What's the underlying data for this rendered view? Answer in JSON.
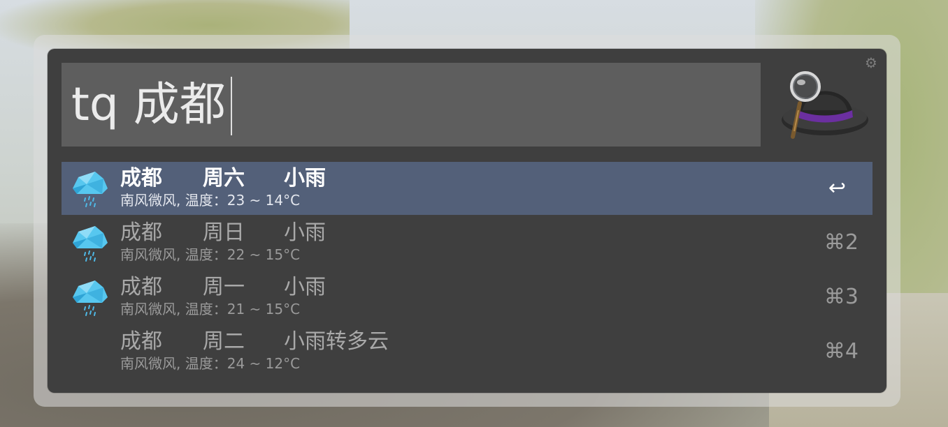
{
  "search": {
    "query": "tq 成都"
  },
  "icons": {
    "settings": "gear-icon",
    "app_logo": "alfred-hat-icon",
    "weather": "rain-cloud-icon"
  },
  "colors": {
    "window_bg": "#3f3f3f",
    "search_bg": "#5e5e5e",
    "selected_row": "#536079",
    "text_primary": "#a9a9a9",
    "text_selected": "#ffffff",
    "hat_band": "#6b2fa0"
  },
  "results": [
    {
      "city": "成都",
      "day": "周六",
      "weather": "小雨",
      "subtitle": "南风微风, 温度：23 ~ 14°C",
      "shortcut": "↩",
      "selected": true,
      "has_icon": true
    },
    {
      "city": "成都",
      "day": "周日",
      "weather": "小雨",
      "subtitle": "南风微风, 温度：22 ~ 15°C",
      "shortcut": "⌘2",
      "selected": false,
      "has_icon": true
    },
    {
      "city": "成都",
      "day": "周一",
      "weather": "小雨",
      "subtitle": "南风微风, 温度：21 ~ 15°C",
      "shortcut": "⌘3",
      "selected": false,
      "has_icon": true
    },
    {
      "city": "成都",
      "day": "周二",
      "weather": "小雨转多云",
      "subtitle": "南风微风, 温度：24 ~ 12°C",
      "shortcut": "⌘4",
      "selected": false,
      "has_icon": false
    }
  ]
}
